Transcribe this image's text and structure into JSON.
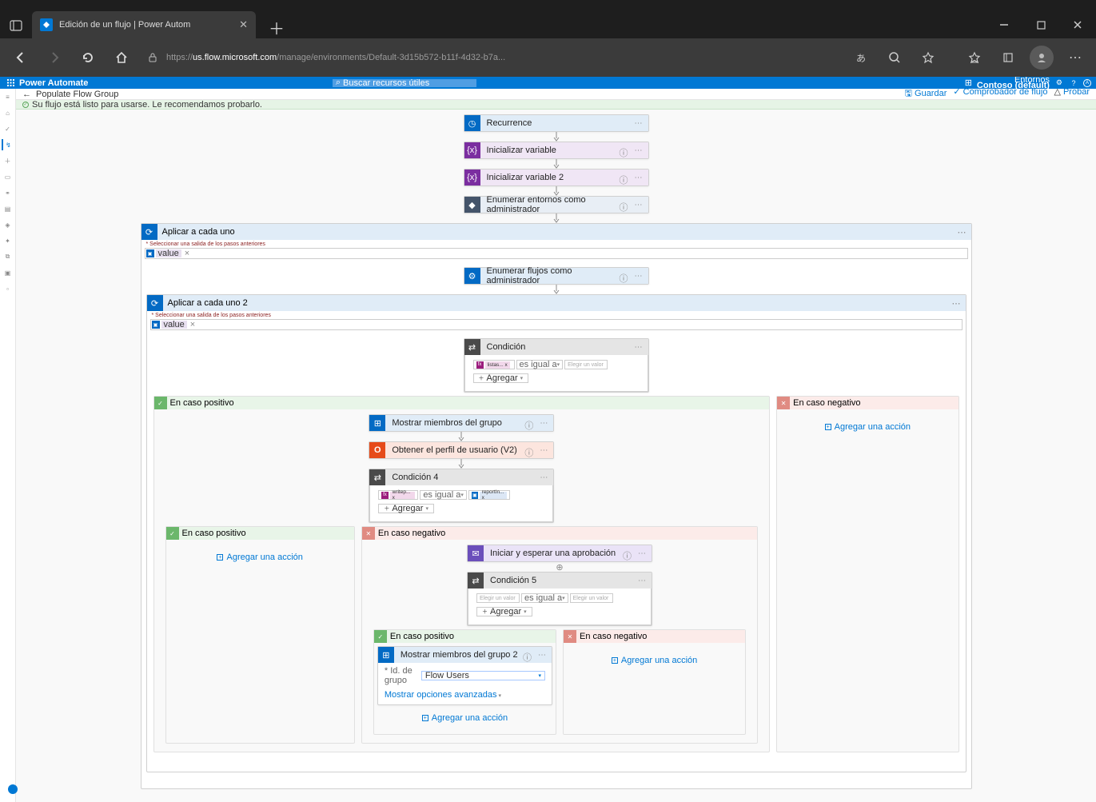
{
  "browser": {
    "tab_title": "Edición de un flujo | Power Autom",
    "url_host": "us.flow.microsoft.com",
    "url_prefix": "https://",
    "url_path": "/manage/environments/Default-3d15b572-b11f-4d32-b7a..."
  },
  "pa": {
    "brand": "Power Automate",
    "search_ph": "Buscar recursos útiles",
    "env_label": "Entornos",
    "env_name": "Contoso (default)"
  },
  "crumb": {
    "back": "←",
    "name": "Populate Flow Group",
    "save": "Guardar",
    "checker": "Comprobador de flujo",
    "test": "Probar"
  },
  "banner": {
    "msg": "Su flujo está listo para usarse. Le recomendamos probarlo."
  },
  "flow": {
    "recur": "Recurrence",
    "var1": "Inicializar variable",
    "var2": "Inicializar variable 2",
    "admin_env": "Enumerar entornos como administrador",
    "foreach1": "Aplicar a cada uno",
    "foreach1_label": "* Seleccionar una salida de los pasos anteriores",
    "foreach1_token": "value",
    "admin_flows": "Enumerar flujos como administrador",
    "foreach2": "Aplicar a cada uno 2",
    "foreach2_label": "* Seleccionar una salida de los pasos anteriores",
    "foreach2_token": "value",
    "cond": "Condición",
    "cond_token": "listas... x",
    "cond_op": "es igual a",
    "cond_val_ph": "Elegir un valor",
    "add": "Agregar",
    "pos": "En caso positivo",
    "neg": "En caso negativo",
    "add_action": "Agregar una acción",
    "group_members": "Mostrar miembros del grupo",
    "o365_profile": "Obtener el perfil de usuario (V2)",
    "cond4": "Condición 4",
    "cond4_l": "writep... x",
    "cond4_r": "reportIn... x",
    "pos2": "En caso positivo",
    "neg2": "En caso negativo",
    "approval": "Iniciar y esperar una aprobación",
    "cond5": "Condición 5",
    "cond5_ph": "Elegir un valor",
    "pos3": "En caso positivo",
    "neg3": "En caso negativo",
    "group_members2": "Mostrar miembros del grupo 2",
    "gm2_field": "* Id. de grupo",
    "gm2_value": "Flow Users",
    "show_advanced": "Mostrar opciones avanzadas"
  }
}
